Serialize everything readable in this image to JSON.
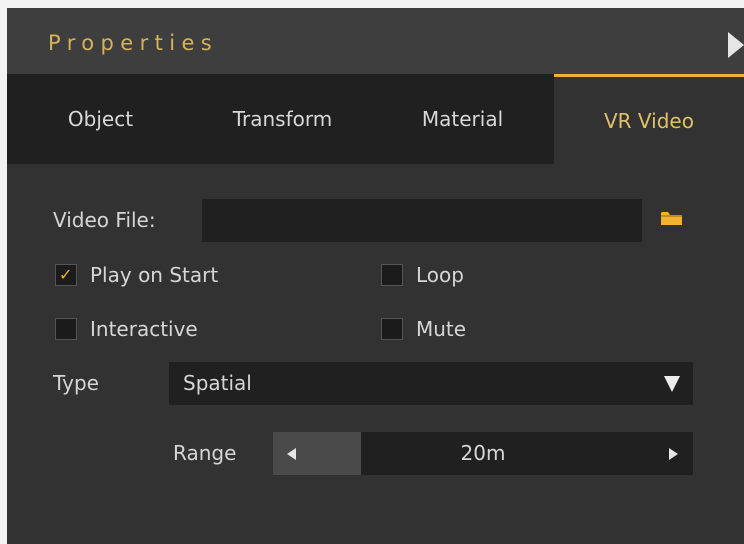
{
  "panel": {
    "title": "Properties",
    "colors": {
      "accent": "#f0b32e",
      "title_text": "#d8b256",
      "panel_bg": "#323232",
      "field_bg": "#202020"
    }
  },
  "tabs": [
    {
      "label": "Object",
      "active": false
    },
    {
      "label": "Transform",
      "active": false
    },
    {
      "label": "Material",
      "active": false
    },
    {
      "label": "VR Video",
      "active": true
    }
  ],
  "video_file": {
    "label": "Video File:",
    "value": "",
    "browse_icon": "folder-icon"
  },
  "options": {
    "play_on_start": {
      "label": "Play on Start",
      "checked": true
    },
    "loop": {
      "label": "Loop",
      "checked": false
    },
    "interactive": {
      "label": "Interactive",
      "checked": false
    },
    "mute": {
      "label": "Mute",
      "checked": false
    }
  },
  "type": {
    "label": "Type",
    "selected": "Spatial"
  },
  "range": {
    "label": "Range",
    "value_text": "20m",
    "fill_fraction": 0.21
  }
}
